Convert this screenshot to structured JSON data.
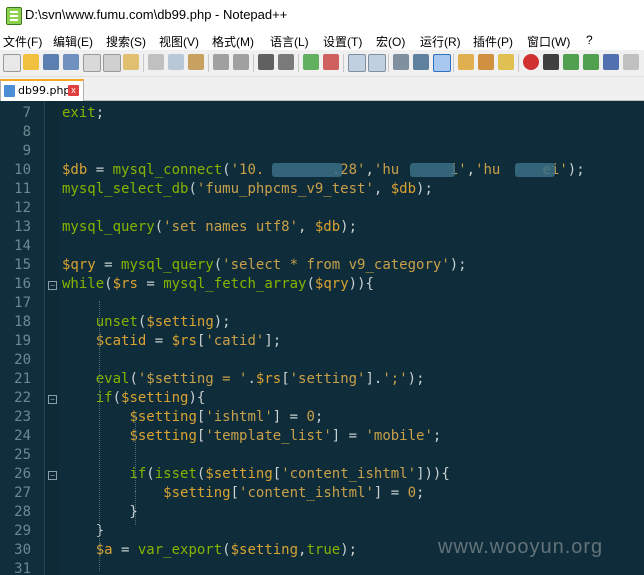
{
  "window": {
    "title": "D:\\svn\\www.fumu.com\\db99.php - Notepad++"
  },
  "menu": [
    "文件(F)",
    "编辑(E)",
    "搜索(S)",
    "视图(V)",
    "格式(M)",
    "语言(L)",
    "设置(T)",
    "宏(O)",
    "运行(R)",
    "插件(P)",
    "窗口(W)",
    "?"
  ],
  "tab": {
    "label": "db99.php",
    "close": "x"
  },
  "lines": [
    {
      "n": "7",
      "tokens": [
        [
          "kw",
          "exit"
        ],
        [
          "op",
          ";"
        ]
      ]
    },
    {
      "n": "8",
      "tokens": []
    },
    {
      "n": "9",
      "tokens": []
    },
    {
      "n": "10",
      "tokens": [
        [
          "var",
          "$db"
        ],
        [
          "op",
          " = "
        ],
        [
          "fn",
          "mysql_connect"
        ],
        [
          "op",
          "("
        ],
        [
          "str",
          "'10.        .28'"
        ],
        [
          "op",
          ","
        ],
        [
          "str",
          "'hu      i'"
        ],
        [
          "op",
          ","
        ],
        [
          "str",
          "'hu     ei'"
        ],
        [
          "op",
          ");"
        ]
      ]
    },
    {
      "n": "11",
      "tokens": [
        [
          "fn",
          "mysql_select_db"
        ],
        [
          "op",
          "("
        ],
        [
          "str",
          "'fumu_phpcms_v9_test'"
        ],
        [
          "op",
          ", "
        ],
        [
          "var",
          "$db"
        ],
        [
          "op",
          ");"
        ]
      ]
    },
    {
      "n": "12",
      "tokens": []
    },
    {
      "n": "13",
      "tokens": [
        [
          "fn",
          "mysql_query"
        ],
        [
          "op",
          "("
        ],
        [
          "str",
          "'set names utf8'"
        ],
        [
          "op",
          ", "
        ],
        [
          "var",
          "$db"
        ],
        [
          "op",
          ");"
        ]
      ]
    },
    {
      "n": "14",
      "tokens": []
    },
    {
      "n": "15",
      "tokens": [
        [
          "var",
          "$qry"
        ],
        [
          "op",
          " = "
        ],
        [
          "fn",
          "mysql_query"
        ],
        [
          "op",
          "("
        ],
        [
          "str",
          "'select * from v9_category'"
        ],
        [
          "op",
          ");"
        ]
      ]
    },
    {
      "n": "16",
      "tokens": [
        [
          "kw",
          "while"
        ],
        [
          "op",
          "("
        ],
        [
          "var",
          "$rs"
        ],
        [
          "op",
          " = "
        ],
        [
          "fn",
          "mysql_fetch_array"
        ],
        [
          "op",
          "("
        ],
        [
          "var",
          "$qry"
        ],
        [
          "op",
          "))"
        ],
        [
          "op",
          "{"
        ]
      ]
    },
    {
      "n": "17",
      "tokens": []
    },
    {
      "n": "18",
      "tokens": [
        [
          "op",
          "    "
        ],
        [
          "fn",
          "unset"
        ],
        [
          "op",
          "("
        ],
        [
          "var",
          "$setting"
        ],
        [
          "op",
          ");"
        ]
      ]
    },
    {
      "n": "19",
      "tokens": [
        [
          "op",
          "    "
        ],
        [
          "var",
          "$catid"
        ],
        [
          "op",
          " = "
        ],
        [
          "var",
          "$rs"
        ],
        [
          "op",
          "["
        ],
        [
          "str",
          "'catid'"
        ],
        [
          "op",
          "];"
        ]
      ]
    },
    {
      "n": "20",
      "tokens": []
    },
    {
      "n": "21",
      "tokens": [
        [
          "op",
          "    "
        ],
        [
          "fn",
          "eval"
        ],
        [
          "op",
          "("
        ],
        [
          "str",
          "'$setting = '"
        ],
        [
          "op",
          "."
        ],
        [
          "var",
          "$rs"
        ],
        [
          "op",
          "["
        ],
        [
          "str",
          "'setting'"
        ],
        [
          "op",
          "]."
        ],
        [
          "str",
          "';'"
        ],
        [
          "op",
          ");"
        ]
      ]
    },
    {
      "n": "22",
      "tokens": [
        [
          "op",
          "    "
        ],
        [
          "kw",
          "if"
        ],
        [
          "op",
          "("
        ],
        [
          "var",
          "$setting"
        ],
        [
          "op",
          "){"
        ]
      ]
    },
    {
      "n": "23",
      "tokens": [
        [
          "op",
          "        "
        ],
        [
          "var",
          "$setting"
        ],
        [
          "op",
          "["
        ],
        [
          "str",
          "'ishtml'"
        ],
        [
          "op",
          "] = "
        ],
        [
          "str",
          "0"
        ],
        [
          "op",
          ";"
        ]
      ]
    },
    {
      "n": "24",
      "tokens": [
        [
          "op",
          "        "
        ],
        [
          "var",
          "$setting"
        ],
        [
          "op",
          "["
        ],
        [
          "str",
          "'template_list'"
        ],
        [
          "op",
          "] = "
        ],
        [
          "str",
          "'mobile'"
        ],
        [
          "op",
          ";"
        ]
      ]
    },
    {
      "n": "25",
      "tokens": []
    },
    {
      "n": "26",
      "tokens": [
        [
          "op",
          "        "
        ],
        [
          "kw",
          "if"
        ],
        [
          "op",
          "("
        ],
        [
          "fn",
          "isset"
        ],
        [
          "op",
          "("
        ],
        [
          "var",
          "$setting"
        ],
        [
          "op",
          "["
        ],
        [
          "str",
          "'content_ishtml'"
        ],
        [
          "op",
          "])){"
        ]
      ]
    },
    {
      "n": "27",
      "tokens": [
        [
          "op",
          "            "
        ],
        [
          "var",
          "$setting"
        ],
        [
          "op",
          "["
        ],
        [
          "str",
          "'content_ishtml'"
        ],
        [
          "op",
          "] = "
        ],
        [
          "str",
          "0"
        ],
        [
          "op",
          ";"
        ]
      ]
    },
    {
      "n": "28",
      "tokens": [
        [
          "op",
          "        }"
        ]
      ]
    },
    {
      "n": "29",
      "tokens": [
        [
          "op",
          "    }"
        ]
      ]
    },
    {
      "n": "30",
      "tokens": [
        [
          "op",
          "    "
        ],
        [
          "var",
          "$a"
        ],
        [
          "op",
          " = "
        ],
        [
          "fn",
          "var_export"
        ],
        [
          "op",
          "("
        ],
        [
          "var",
          "$setting"
        ],
        [
          "op",
          ","
        ],
        [
          "kw",
          "true"
        ],
        [
          "op",
          ");"
        ]
      ]
    },
    {
      "n": "31",
      "tokens": []
    }
  ],
  "watermark": "www.wooyun.org",
  "colors": {
    "editor_bg": "#0f2c3a",
    "keyword": "#86b300",
    "variable": "#d8a332",
    "string": "#c8a04a",
    "text": "#c8d0d0",
    "line_number": "#6c8892",
    "tab_accent": "#f5a623"
  },
  "toolbar_icons": [
    "new-file-icon",
    "open-file-icon",
    "save-icon",
    "save-all-icon",
    "close-icon",
    "close-all-icon",
    "print-icon",
    "cut-icon",
    "copy-icon",
    "paste-icon",
    "undo-icon",
    "redo-icon",
    "find-icon",
    "replace-icon",
    "zoom-in-icon",
    "zoom-out-icon",
    "sync-v-icon",
    "sync-h-icon",
    "wrap-icon",
    "all-chars-icon",
    "indent-guide-icon",
    "doc-map-icon",
    "function-list-icon",
    "folder-workspace-icon",
    "record-macro-icon",
    "stop-macro-icon"
  ]
}
